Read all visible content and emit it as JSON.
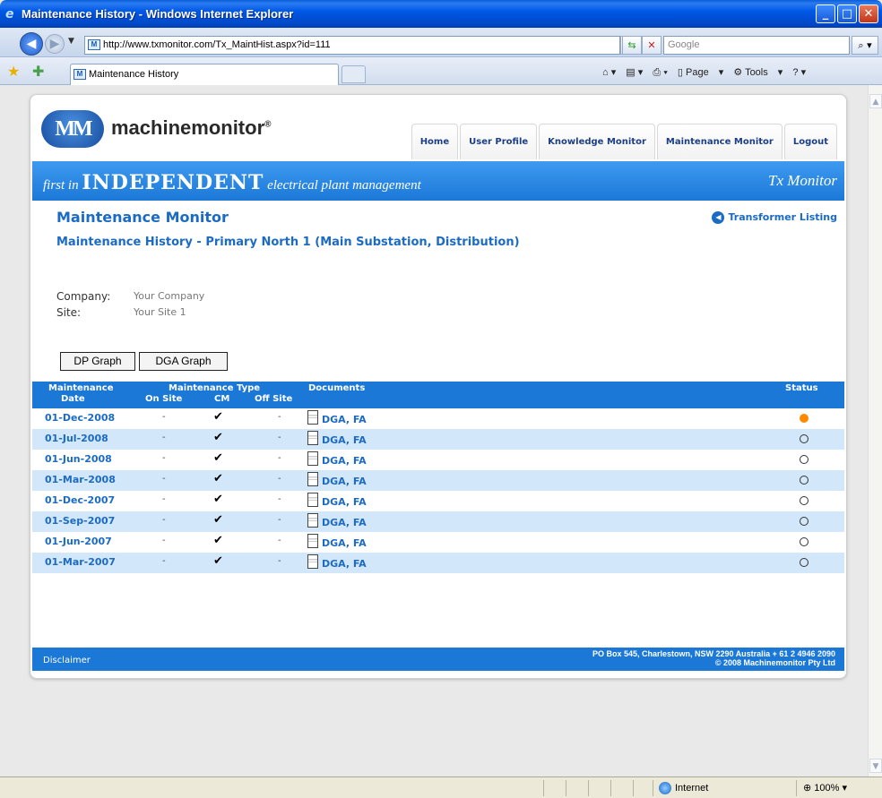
{
  "window": {
    "title": "Maintenance History - Windows Internet Explorer",
    "url": "http://www.txmonitor.com/Tx_MaintHist.aspx?id=111",
    "search_placeholder": "Google",
    "tab_title": "Maintenance History",
    "cmd_page": "Page",
    "cmd_tools": "Tools",
    "status_zone": "Internet",
    "zoom": "100%"
  },
  "site": {
    "brand": "machinemonitor",
    "logo_text": "MM",
    "nav": [
      "Home",
      "User Profile",
      "Knowledge Monitor",
      "Maintenance Monitor",
      "Logout"
    ],
    "tagline_pre": "first in",
    "tagline_bold": "INDEPENDENT",
    "tagline_post": "electrical plant management",
    "tx_monitor": "Tx Monitor"
  },
  "page": {
    "title": "Maintenance Monitor",
    "subtitle": "Maintenance History - Primary North 1 (Main Substation, Distribution)",
    "back_link": "Transformer Listing",
    "company_label": "Company:",
    "company_value": "Your Company",
    "site_label": "Site:",
    "site_value": "Your Site 1",
    "buttons": {
      "dp_graph": "DP Graph",
      "dga_graph": "DGA Graph"
    }
  },
  "table": {
    "headers": {
      "maint_date_1": "Maintenance",
      "maint_date_2": "Date",
      "maint_type": "Maintenance Type",
      "on_site": "On Site",
      "cm": "CM",
      "off_site": "Off Site",
      "documents": "Documents",
      "status": "Status"
    },
    "rows": [
      {
        "date": "01-Dec-2008",
        "on_site": "-",
        "cm": "✔",
        "off_site": "-",
        "docs": "DGA, FA",
        "status": "active"
      },
      {
        "date": "01-Jul-2008",
        "on_site": "-",
        "cm": "✔",
        "off_site": "-",
        "docs": "DGA, FA",
        "status": "inactive"
      },
      {
        "date": "01-Jun-2008",
        "on_site": "-",
        "cm": "✔",
        "off_site": "-",
        "docs": "DGA, FA",
        "status": "inactive"
      },
      {
        "date": "01-Mar-2008",
        "on_site": "-",
        "cm": "✔",
        "off_site": "-",
        "docs": "DGA, FA",
        "status": "inactive"
      },
      {
        "date": "01-Dec-2007",
        "on_site": "-",
        "cm": "✔",
        "off_site": "-",
        "docs": "DGA, FA",
        "status": "inactive"
      },
      {
        "date": "01-Sep-2007",
        "on_site": "-",
        "cm": "✔",
        "off_site": "-",
        "docs": "DGA, FA",
        "status": "inactive"
      },
      {
        "date": "01-Jun-2007",
        "on_site": "-",
        "cm": "✔",
        "off_site": "-",
        "docs": "DGA, FA",
        "status": "inactive"
      },
      {
        "date": "01-Mar-2007",
        "on_site": "-",
        "cm": "✔",
        "off_site": "-",
        "docs": "DGA, FA",
        "status": "inactive"
      }
    ]
  },
  "footer": {
    "disclaimer": "Disclaimer",
    "address": "PO Box 545, Charlestown, NSW 2290 Australia + 61 2 4946 2090",
    "copyright": "© 2008 Machinemonitor Pty Ltd"
  },
  "colors": {
    "accent": "#1b78d7",
    "link": "#1b6bc4",
    "status_active": "#ff8a00",
    "row_alt": "#d3e7fa"
  }
}
